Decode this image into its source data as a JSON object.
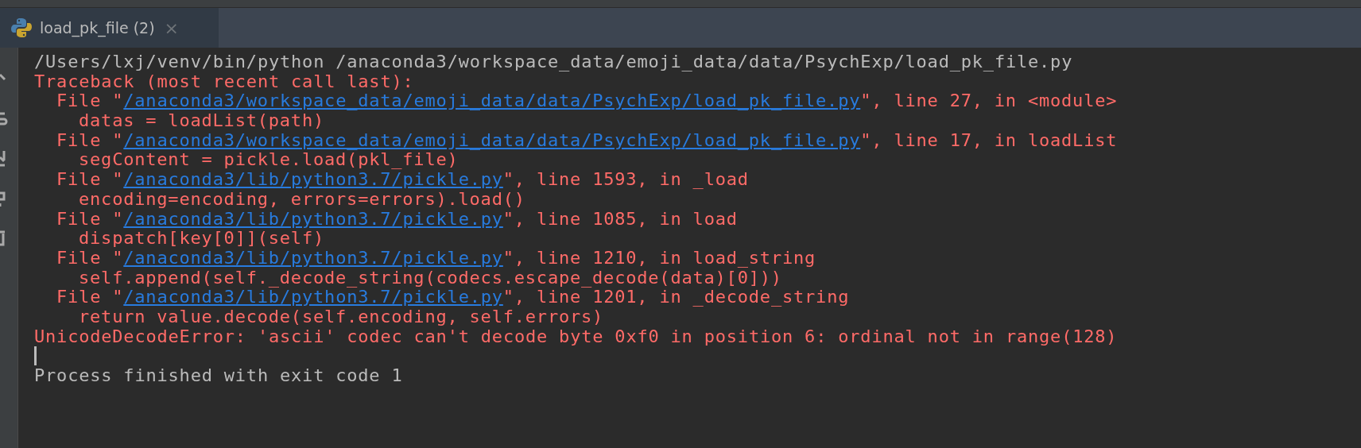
{
  "tab": {
    "title": "load_pk_file (2)",
    "close": "×",
    "selected": true
  },
  "console": {
    "lines": [
      {
        "kind": "command",
        "text": "/Users/lxj/venv/bin/python /anaconda3/workspace_data/emoji_data/data/PsychExp/load_pk_file.py"
      },
      {
        "kind": "error",
        "text": "Traceback (most recent call last):"
      },
      {
        "kind": "frame",
        "prefix": "File \"",
        "path": "/anaconda3/workspace_data/emoji_data/data/PsychExp/load_pk_file.py",
        "suffix": "\", line 27, in <module>"
      },
      {
        "kind": "code",
        "text": "datas = loadList(path)"
      },
      {
        "kind": "frame",
        "prefix": "File \"",
        "path": "/anaconda3/workspace_data/emoji_data/data/PsychExp/load_pk_file.py",
        "suffix": "\", line 17, in loadList"
      },
      {
        "kind": "code",
        "text": "segContent = pickle.load(pkl_file)"
      },
      {
        "kind": "frame",
        "prefix": "File \"",
        "path": "/anaconda3/lib/python3.7/pickle.py",
        "suffix": "\", line 1593, in _load"
      },
      {
        "kind": "code",
        "text": "encoding=encoding, errors=errors).load()"
      },
      {
        "kind": "frame",
        "prefix": "File \"",
        "path": "/anaconda3/lib/python3.7/pickle.py",
        "suffix": "\", line 1085, in load"
      },
      {
        "kind": "code",
        "text": "dispatch[key[0]](self)"
      },
      {
        "kind": "frame",
        "prefix": "File \"",
        "path": "/anaconda3/lib/python3.7/pickle.py",
        "suffix": "\", line 1210, in load_string"
      },
      {
        "kind": "code",
        "text": "self.append(self._decode_string(codecs.escape_decode(data)[0]))"
      },
      {
        "kind": "frame",
        "prefix": "File \"",
        "path": "/anaconda3/lib/python3.7/pickle.py",
        "suffix": "\", line 1201, in _decode_string"
      },
      {
        "kind": "code",
        "text": "return value.decode(self.encoding, self.errors)"
      },
      {
        "kind": "error",
        "text": "UnicodeDecodeError: 'ascii' codec can't decode byte 0xf0 in position 6: ordinal not in range(128)"
      },
      {
        "kind": "cursor"
      },
      {
        "kind": "process",
        "text": "Process finished with exit code 1"
      }
    ]
  }
}
